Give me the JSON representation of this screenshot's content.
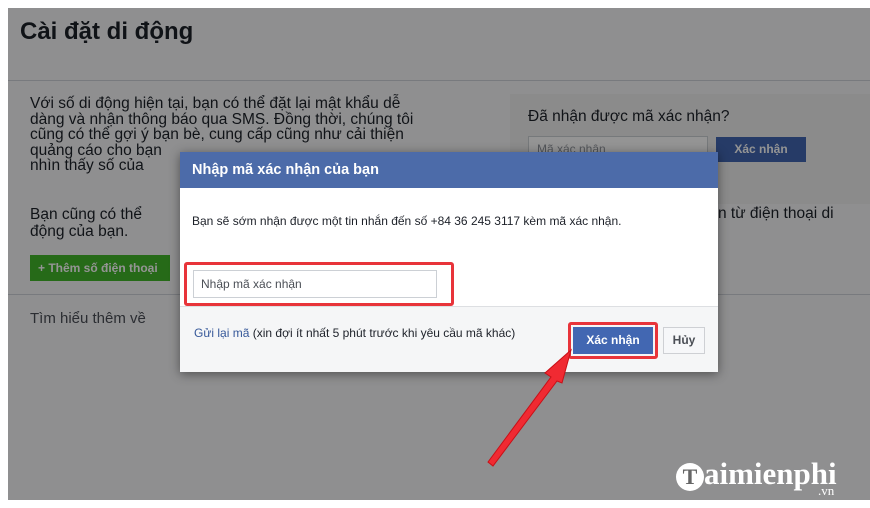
{
  "page": {
    "title": "Cài đặt di động",
    "para1": [
      "Với số di động hiện tại, bạn có thể đặt lại mật khẩu dễ",
      "dàng và nhận thông báo qua SMS. Đồng thời, chúng tôi",
      "cũng có thể gợi ý bạn bè, cung cấp cũng như cải thiện",
      "quảng cáo cho bạn",
      "nhìn thấy số của"
    ],
    "para2": [
      "Bạn cũng có thể",
      "động của bạn."
    ],
    "add_button": "+ Thêm số điện thoại",
    "learn_more": "Tìm hiểu thêm về",
    "right_title": "Đã nhận được mã xác nhận?",
    "right_placeholder": "Mã xác nhận",
    "right_button": "Xác nhận",
    "right_text": "n từ điện thoại di"
  },
  "dialog": {
    "title": "Nhập mã xác nhận của bạn",
    "message": "Bạn sẽ sớm nhận được một tin nhắn đến số +84 36 245 3117 kèm mã xác nhận.",
    "input_placeholder": "Nhập mã xác nhận",
    "resend_link": "Gửi lại mã",
    "resend_note": " (xin đợi ít nhất 5 phút trước khi yêu cầu mã khác)",
    "confirm_button": "Xác nhận",
    "cancel_button": "Hủy"
  },
  "watermark": {
    "logo_first": "T",
    "logo_rest": "aimienphi",
    "logo_domain": ".vn"
  },
  "colors": {
    "header_blue": "#4c6ba9",
    "button_blue": "#4267b2",
    "highlight_red": "#e8343a",
    "green": "#42b72a"
  }
}
